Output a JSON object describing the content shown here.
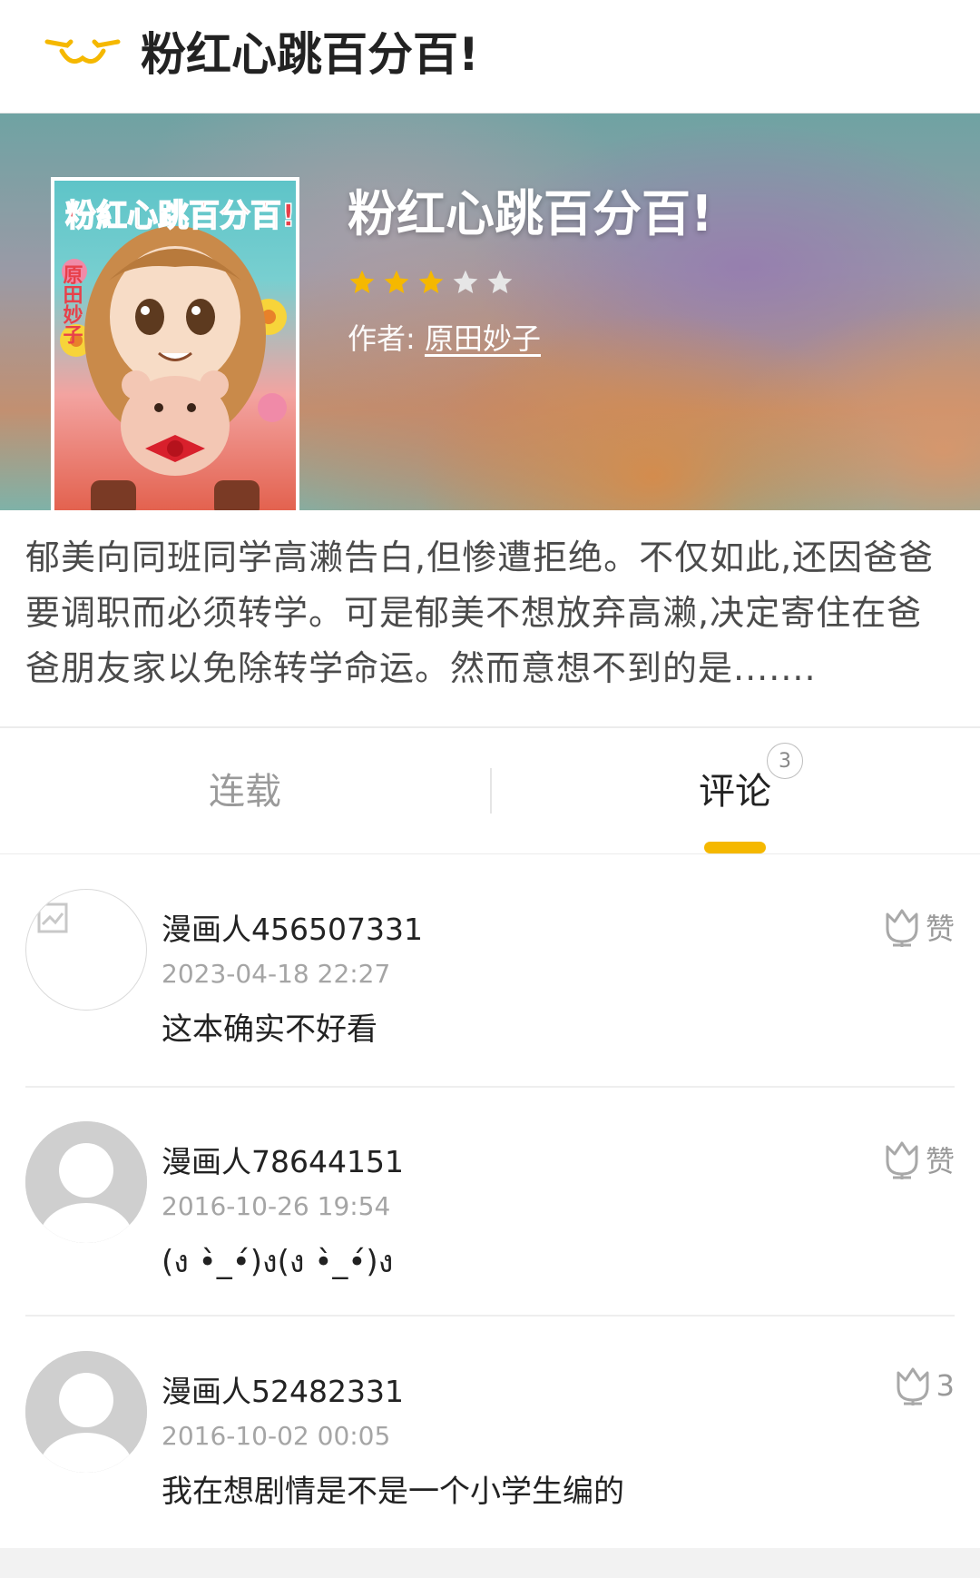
{
  "header": {
    "title": "粉红心跳百分百!",
    "back_icon": "back-cat-icon"
  },
  "book": {
    "title": "粉红心跳百分百!",
    "rating": 3,
    "rating_max": 5,
    "author_label": "作者:",
    "author_name": "原田妙子",
    "cover_title": "粉紅心跳百分百!",
    "cover_author": "原田妙子",
    "description": "郁美向同班同学高濑告白,但惨遭拒绝。不仅如此,还因爸爸要调职而必须转学。可是郁美不想放弃高濑,决定寄住在爸爸朋友家以免除转学命运。然而意想不到的是......."
  },
  "tabs": [
    {
      "label": "连载",
      "active": false
    },
    {
      "label": "评论",
      "active": true,
      "badge": "3"
    }
  ],
  "colors": {
    "accent": "#f5b800",
    "star_on": "#f5b800",
    "star_off": "#e6e6e6"
  },
  "comments": [
    {
      "user": "漫画人456507331",
      "time": "2023-04-18 22:27",
      "text": "这本确实不好看",
      "like_label": "赞",
      "avatar": "broken-image-icon"
    },
    {
      "user": "漫画人78644151",
      "time": "2016-10-26 19:54",
      "text": "(ง •̀_•́)ง(ง •̀_•́)ง",
      "like_label": "赞",
      "avatar": "default-avatar-icon"
    },
    {
      "user": "漫画人52482331",
      "time": "2016-10-02 00:05",
      "text": "我在想剧情是不是一个小学生编的",
      "like_label": "3",
      "avatar": "default-avatar-icon"
    }
  ]
}
